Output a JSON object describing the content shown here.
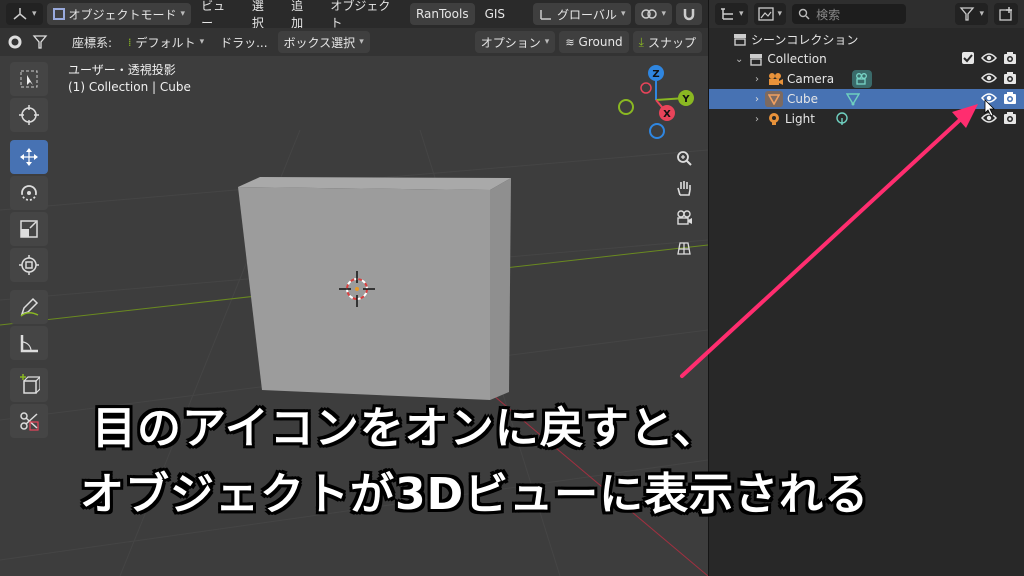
{
  "header1": {
    "mode_label": "オブジェクトモード",
    "menus": [
      "ビュー",
      "選択",
      "追加",
      "オブジェクト"
    ],
    "addon_menu": "RanTools",
    "gis_menu": "GIS",
    "transform_orientation": "グローバル"
  },
  "header2": {
    "coord_label": "座標系:",
    "coord_value": "デフォルト",
    "drag_label": "ドラッ...",
    "select_mode": "ボックス選択",
    "options_label": "オプション",
    "ground_label": "Ground",
    "snap_label": "スナップ"
  },
  "viewport": {
    "view_name": "ユーザー・透視投影",
    "object_info": "(1) Collection | Cube"
  },
  "gizmo": {
    "x_label": "X",
    "y_label": "Y",
    "z_label": "Z"
  },
  "outliner": {
    "search_placeholder": "検索",
    "scene_collection": "シーンコレクション",
    "collection": "Collection",
    "items": [
      {
        "label": "Camera"
      },
      {
        "label": "Cube"
      },
      {
        "label": "Light"
      }
    ]
  },
  "caption": {
    "line1": "目のアイコンをオンに戻すと、",
    "line2": "オブジェクトが3Dビューに表示される"
  },
  "colors": {
    "accent_blue": "#4772b3",
    "annotation_pink": "#ff2d6f",
    "axis_x": "#e8445a",
    "axis_y": "#8ab822",
    "axis_z": "#2f86e0"
  }
}
